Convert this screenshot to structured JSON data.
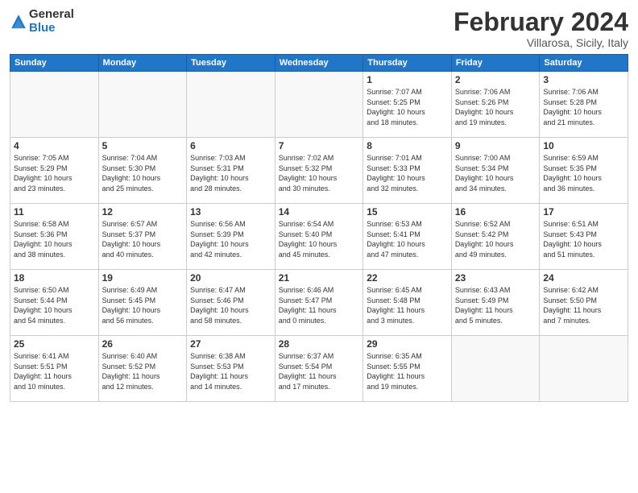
{
  "logo": {
    "general": "General",
    "blue": "Blue"
  },
  "title": "February 2024",
  "location": "Villarosa, Sicily, Italy",
  "days_header": [
    "Sunday",
    "Monday",
    "Tuesday",
    "Wednesday",
    "Thursday",
    "Friday",
    "Saturday"
  ],
  "weeks": [
    [
      {
        "day": "",
        "info": ""
      },
      {
        "day": "",
        "info": ""
      },
      {
        "day": "",
        "info": ""
      },
      {
        "day": "",
        "info": ""
      },
      {
        "day": "1",
        "info": "Sunrise: 7:07 AM\nSunset: 5:25 PM\nDaylight: 10 hours\nand 18 minutes."
      },
      {
        "day": "2",
        "info": "Sunrise: 7:06 AM\nSunset: 5:26 PM\nDaylight: 10 hours\nand 19 minutes."
      },
      {
        "day": "3",
        "info": "Sunrise: 7:06 AM\nSunset: 5:28 PM\nDaylight: 10 hours\nand 21 minutes."
      }
    ],
    [
      {
        "day": "4",
        "info": "Sunrise: 7:05 AM\nSunset: 5:29 PM\nDaylight: 10 hours\nand 23 minutes."
      },
      {
        "day": "5",
        "info": "Sunrise: 7:04 AM\nSunset: 5:30 PM\nDaylight: 10 hours\nand 25 minutes."
      },
      {
        "day": "6",
        "info": "Sunrise: 7:03 AM\nSunset: 5:31 PM\nDaylight: 10 hours\nand 28 minutes."
      },
      {
        "day": "7",
        "info": "Sunrise: 7:02 AM\nSunset: 5:32 PM\nDaylight: 10 hours\nand 30 minutes."
      },
      {
        "day": "8",
        "info": "Sunrise: 7:01 AM\nSunset: 5:33 PM\nDaylight: 10 hours\nand 32 minutes."
      },
      {
        "day": "9",
        "info": "Sunrise: 7:00 AM\nSunset: 5:34 PM\nDaylight: 10 hours\nand 34 minutes."
      },
      {
        "day": "10",
        "info": "Sunrise: 6:59 AM\nSunset: 5:35 PM\nDaylight: 10 hours\nand 36 minutes."
      }
    ],
    [
      {
        "day": "11",
        "info": "Sunrise: 6:58 AM\nSunset: 5:36 PM\nDaylight: 10 hours\nand 38 minutes."
      },
      {
        "day": "12",
        "info": "Sunrise: 6:57 AM\nSunset: 5:37 PM\nDaylight: 10 hours\nand 40 minutes."
      },
      {
        "day": "13",
        "info": "Sunrise: 6:56 AM\nSunset: 5:39 PM\nDaylight: 10 hours\nand 42 minutes."
      },
      {
        "day": "14",
        "info": "Sunrise: 6:54 AM\nSunset: 5:40 PM\nDaylight: 10 hours\nand 45 minutes."
      },
      {
        "day": "15",
        "info": "Sunrise: 6:53 AM\nSunset: 5:41 PM\nDaylight: 10 hours\nand 47 minutes."
      },
      {
        "day": "16",
        "info": "Sunrise: 6:52 AM\nSunset: 5:42 PM\nDaylight: 10 hours\nand 49 minutes."
      },
      {
        "day": "17",
        "info": "Sunrise: 6:51 AM\nSunset: 5:43 PM\nDaylight: 10 hours\nand 51 minutes."
      }
    ],
    [
      {
        "day": "18",
        "info": "Sunrise: 6:50 AM\nSunset: 5:44 PM\nDaylight: 10 hours\nand 54 minutes."
      },
      {
        "day": "19",
        "info": "Sunrise: 6:49 AM\nSunset: 5:45 PM\nDaylight: 10 hours\nand 56 minutes."
      },
      {
        "day": "20",
        "info": "Sunrise: 6:47 AM\nSunset: 5:46 PM\nDaylight: 10 hours\nand 58 minutes."
      },
      {
        "day": "21",
        "info": "Sunrise: 6:46 AM\nSunset: 5:47 PM\nDaylight: 11 hours\nand 0 minutes."
      },
      {
        "day": "22",
        "info": "Sunrise: 6:45 AM\nSunset: 5:48 PM\nDaylight: 11 hours\nand 3 minutes."
      },
      {
        "day": "23",
        "info": "Sunrise: 6:43 AM\nSunset: 5:49 PM\nDaylight: 11 hours\nand 5 minutes."
      },
      {
        "day": "24",
        "info": "Sunrise: 6:42 AM\nSunset: 5:50 PM\nDaylight: 11 hours\nand 7 minutes."
      }
    ],
    [
      {
        "day": "25",
        "info": "Sunrise: 6:41 AM\nSunset: 5:51 PM\nDaylight: 11 hours\nand 10 minutes."
      },
      {
        "day": "26",
        "info": "Sunrise: 6:40 AM\nSunset: 5:52 PM\nDaylight: 11 hours\nand 12 minutes."
      },
      {
        "day": "27",
        "info": "Sunrise: 6:38 AM\nSunset: 5:53 PM\nDaylight: 11 hours\nand 14 minutes."
      },
      {
        "day": "28",
        "info": "Sunrise: 6:37 AM\nSunset: 5:54 PM\nDaylight: 11 hours\nand 17 minutes."
      },
      {
        "day": "29",
        "info": "Sunrise: 6:35 AM\nSunset: 5:55 PM\nDaylight: 11 hours\nand 19 minutes."
      },
      {
        "day": "",
        "info": ""
      },
      {
        "day": "",
        "info": ""
      }
    ]
  ]
}
